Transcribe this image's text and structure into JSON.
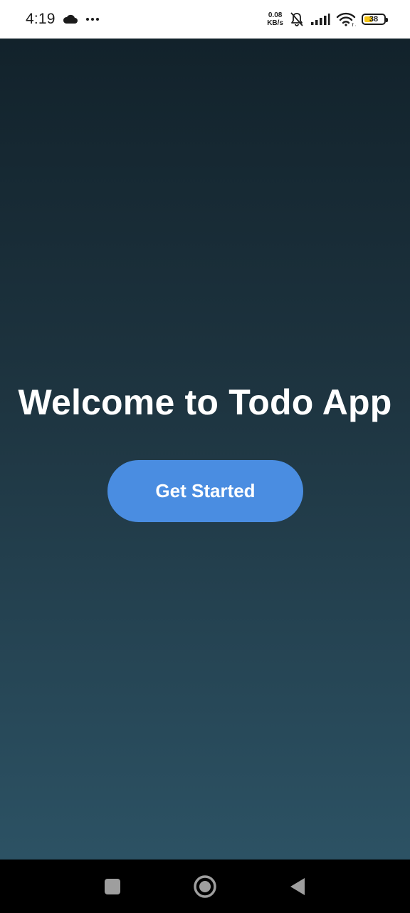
{
  "status_bar": {
    "time": "4:19",
    "cloud_icon": "cloud-icon",
    "more_icon": "more-dots-icon",
    "net_speed_value": "0.08",
    "net_speed_unit": "KB/s",
    "mute_icon": "bell-off-icon",
    "signal_icon": "signal-icon",
    "wifi_icon": "wifi-icon",
    "battery_level": "38",
    "battery_color": "#f5c518"
  },
  "main": {
    "title": "Welcome to Todo App",
    "get_started_label": "Get Started",
    "button_color": "#4a8de1"
  },
  "nav_bar": {
    "recent_icon": "recent-apps-icon",
    "home_icon": "home-icon",
    "back_icon": "back-icon"
  }
}
